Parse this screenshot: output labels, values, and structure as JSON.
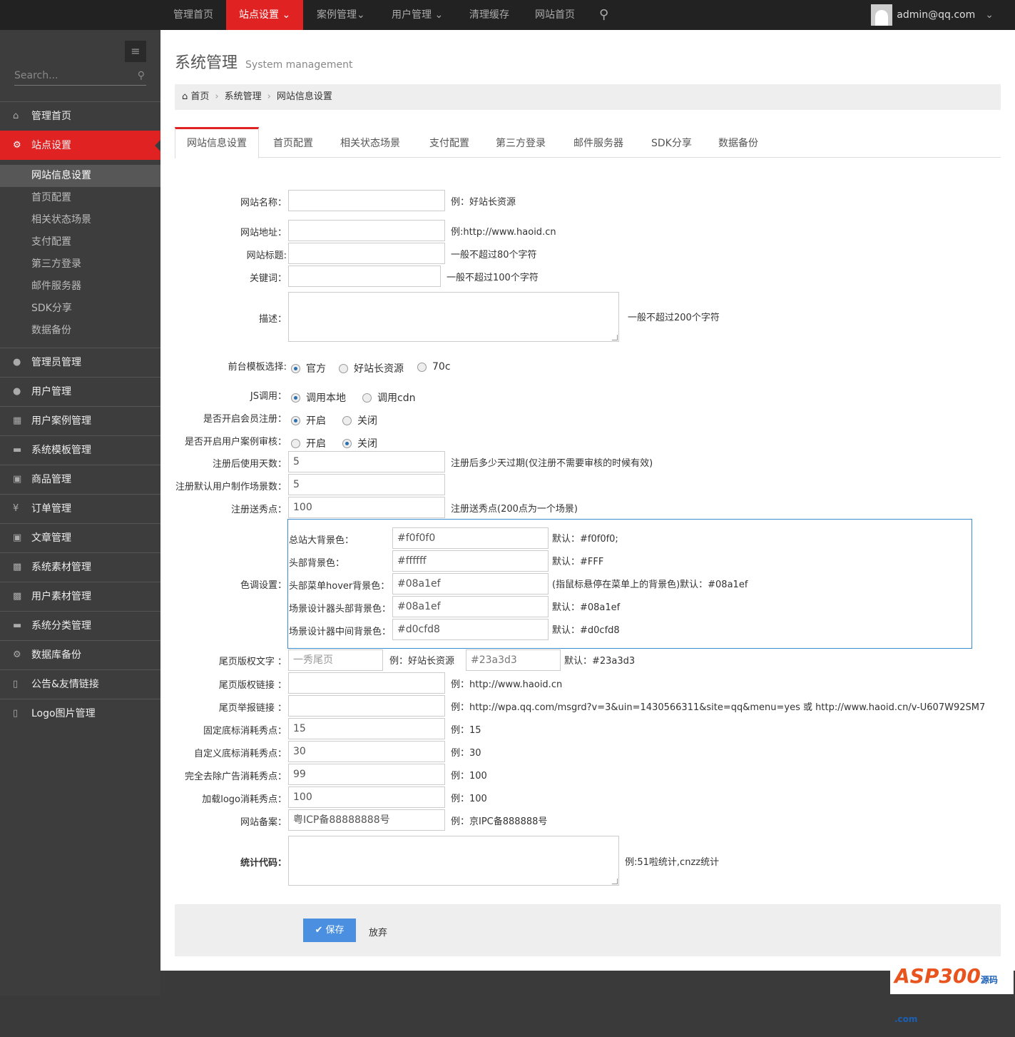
{
  "topnav": {
    "items": [
      {
        "label": "管理首页"
      },
      {
        "label": "站点设置 ⌄"
      },
      {
        "label": "案例管理⌄"
      },
      {
        "label": "用户管理 ⌄"
      },
      {
        "label": "清理缓存"
      },
      {
        "label": "网站首页"
      }
    ],
    "search_icon": "⚲",
    "user": "admin@qq.com",
    "user_caret": "⌄"
  },
  "sidebar": {
    "toggle_icon": "≡",
    "search_placeholder": "Search...",
    "search_icon": "⚲",
    "top_items": [
      {
        "label": "管理首页",
        "icon": "⌂"
      },
      {
        "label": "站点设置",
        "icon": "⚙"
      }
    ],
    "sub_items": [
      "网站信息设置",
      "首页配置",
      "相关状态场景",
      "支付配置",
      "第三方登录",
      "邮件服务器",
      "SDK分享",
      "数据备份"
    ],
    "items": [
      {
        "label": "管理员管理",
        "icon": "●"
      },
      {
        "label": "用户管理",
        "icon": "●"
      },
      {
        "label": "用户案例管理",
        "icon": "▦"
      },
      {
        "label": "系统模板管理",
        "icon": "▬"
      },
      {
        "label": "商品管理",
        "icon": "▣"
      },
      {
        "label": "订单管理",
        "icon": "¥"
      },
      {
        "label": "文章管理",
        "icon": "▣"
      },
      {
        "label": "系统素材管理",
        "icon": "▩"
      },
      {
        "label": "用户素材管理",
        "icon": "▩"
      },
      {
        "label": "系统分类管理",
        "icon": "▬"
      },
      {
        "label": "数据库备份",
        "icon": "⚙"
      },
      {
        "label": "公告&友情链接",
        "icon": "▯"
      },
      {
        "label": "Logo图片管理",
        "icon": "▯"
      }
    ]
  },
  "page": {
    "title": "系统管理",
    "subtitle": "System management",
    "breadcrumb": [
      "⌂ 首页",
      "系统管理",
      "网站信息设置"
    ],
    "sep": "›"
  },
  "tabs": [
    "网站信息设置",
    "首页配置",
    "相关状态场景",
    "支付配置",
    "第三方登录",
    "邮件服务器",
    "SDK分享",
    "数据备份"
  ],
  "form": {
    "inputs": [
      {
        "label": "网站名称：",
        "value": "",
        "hint": "例：好站长资源"
      },
      {
        "label": "网站地址：",
        "value": "",
        "hint": "例:http://www.haoid.cn"
      },
      {
        "label": "网站标题:",
        "value": "",
        "hint": "一般不超过80个字符"
      },
      {
        "label": "关键词：",
        "value": "",
        "hint": "一般不超过100个字符"
      },
      {
        "label": "注册后使用天数：",
        "value": "5",
        "hint": "注册后多少天过期(仅注册不需要审核的时候有效)"
      },
      {
        "label": "注册默认用户制作场景数：",
        "value": "5",
        "hint": ""
      },
      {
        "label": "注册送秀点：",
        "value": "100",
        "hint": "注册送秀点(200点为一个场景)"
      },
      {
        "label": "尾页版权链接 ：",
        "value": "",
        "hint": "例：http://www.haoid.cn"
      },
      {
        "label": "尾页举报链接 ：",
        "value": "",
        "hint": "例：http://wpa.qq.com/msgrd?v=3&uin=1430566311&site=qq&menu=yes 或 http://www.haoid.cn/v-U607W92SM7"
      },
      {
        "label": "固定底标消耗秀点：",
        "value": "15",
        "hint": "例：15"
      },
      {
        "label": "自定义底标消耗秀点：",
        "value": "30",
        "hint": "例：30"
      },
      {
        "label": "完全去除广告消耗秀点：",
        "value": "99",
        "hint": "例：100"
      },
      {
        "label": "加载logo消耗秀点：",
        "value": "100",
        "hint": "例：100"
      },
      {
        "label": "网站备案：",
        "value": "粤ICP备88888888号",
        "hint": "例：京IPC备888888号"
      }
    ],
    "description": {
      "label": "描述：",
      "hint": "一般不超过200个字符"
    },
    "stats": {
      "label": "统计代码：",
      "hint": "例:51啦统计,cnzz统计"
    },
    "radios": [
      {
        "label": "前台模板选择:",
        "options": [
          "官方",
          "好站长资源",
          "70c"
        ],
        "selected": 0
      },
      {
        "label": "JS调用：",
        "options": [
          "调用本地",
          "调用cdn"
        ],
        "selected": 0
      },
      {
        "label": "是否开启会员注册：",
        "options": [
          "开启",
          "关闭"
        ],
        "selected": 0
      },
      {
        "label": "是否开启用户案例审核：",
        "options": [
          "开启",
          "关闭"
        ],
        "selected": 1
      }
    ],
    "colors": {
      "label": "色调设置：",
      "rows": [
        {
          "label": "总站大背景色：",
          "value": "#f0f0f0",
          "hint": "默认：#f0f0f0;"
        },
        {
          "label": "头部背景色：",
          "value": "#ffffff",
          "hint": "默认：#FFF"
        },
        {
          "label": "头部菜单hover背景色：",
          "value": "#08a1ef",
          "hint": "(指鼠标悬停在菜单上的背景色)默认：#08a1ef"
        },
        {
          "label": "场景设计器头部背景色：",
          "value": "#08a1ef",
          "hint": "默认：#08a1ef"
        },
        {
          "label": "场景设计器中间背景色：",
          "value": "#d0cfd8",
          "hint": "默认：#d0cfd8"
        }
      ]
    },
    "footer_text": {
      "label": "尾页版权文字 ：",
      "placeholder": "一秀尾页",
      "hint": "例：好站长资源",
      "color_value": "#23a3d3",
      "color_hint": "默认：#23a3d3"
    }
  },
  "actions": {
    "save_icon": "✔",
    "save": "保存",
    "cancel": "放弃"
  },
  "watermark": {
    "text": "ASP300",
    "suffix": "源码 .com"
  }
}
